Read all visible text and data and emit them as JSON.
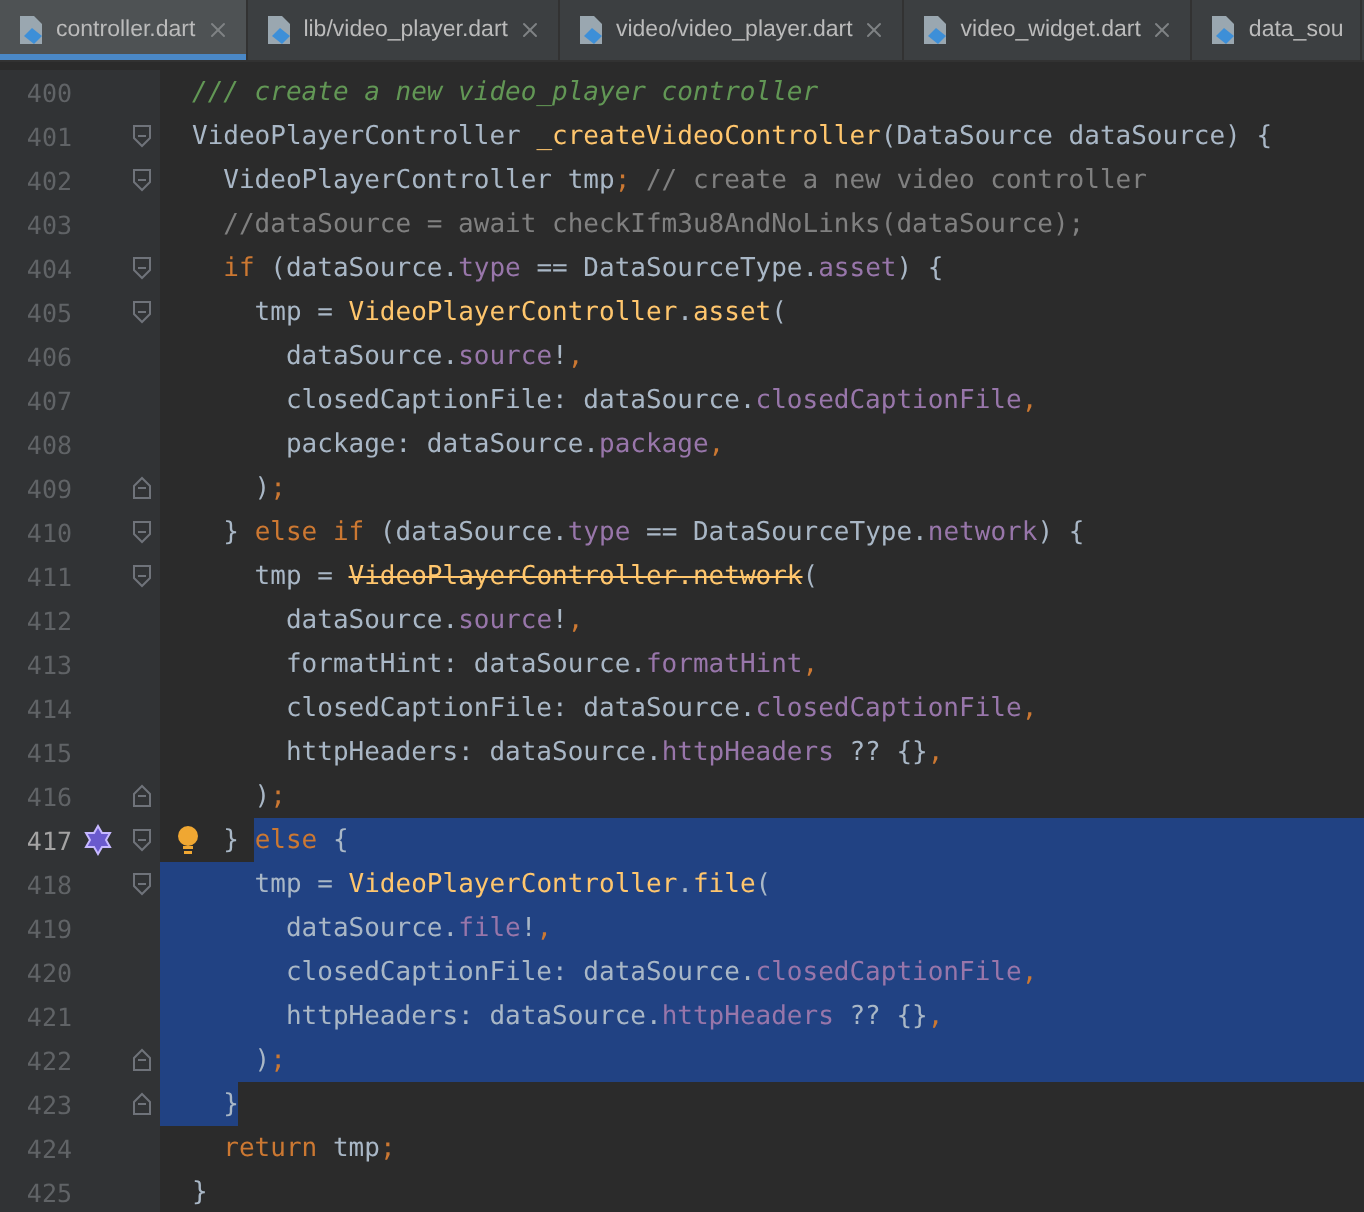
{
  "tabs": [
    {
      "label": "controller.dart",
      "selected": true,
      "closable": true
    },
    {
      "label": "lib/video_player.dart",
      "selected": false,
      "closable": true
    },
    {
      "label": "video/video_player.dart",
      "selected": false,
      "closable": true
    },
    {
      "label": "video_widget.dart",
      "selected": false,
      "closable": true
    },
    {
      "label": "data_sou",
      "selected": false,
      "closable": false
    }
  ],
  "lines": [
    {
      "number": "400",
      "selected": false,
      "tokens": [
        {
          "kind": "doc",
          "text": "/// create a new video_player controller"
        }
      ]
    },
    {
      "number": "401",
      "selected": false,
      "fold_start": true,
      "tokens": [
        {
          "kind": "plain",
          "text": "VideoPlayerController "
        },
        {
          "kind": "function",
          "text": "_createVideoController"
        },
        {
          "kind": "plain",
          "text": "(DataSource dataSource) {"
        }
      ]
    },
    {
      "number": "402",
      "selected": false,
      "fold_start": true,
      "tokens": [
        {
          "kind": "plain",
          "text": "  VideoPlayerController tmp"
        },
        {
          "kind": "keyword",
          "text": ";"
        },
        {
          "kind": "comment",
          "text": " // create a new video controller"
        }
      ]
    },
    {
      "number": "403",
      "selected": false,
      "tokens": [
        {
          "kind": "comment",
          "text": "  //dataSource = await checkIfm3u8AndNoLinks(dataSource);"
        }
      ]
    },
    {
      "number": "404",
      "selected": false,
      "fold_start": true,
      "tokens": [
        {
          "kind": "keyword",
          "text": "  if"
        },
        {
          "kind": "plain",
          "text": " (dataSource."
        },
        {
          "kind": "field",
          "text": "type"
        },
        {
          "kind": "plain",
          "text": " == DataSourceType."
        },
        {
          "kind": "field",
          "text": "asset"
        },
        {
          "kind": "plain",
          "text": ") {"
        }
      ]
    },
    {
      "number": "405",
      "selected": false,
      "fold_start": true,
      "tokens": [
        {
          "kind": "plain",
          "text": "    tmp = "
        },
        {
          "kind": "function",
          "text": "VideoPlayerController"
        },
        {
          "kind": "plain",
          "text": "."
        },
        {
          "kind": "function",
          "text": "asset"
        },
        {
          "kind": "plain",
          "text": "("
        }
      ]
    },
    {
      "number": "406",
      "selected": false,
      "tokens": [
        {
          "kind": "plain",
          "text": "      dataSource."
        },
        {
          "kind": "field",
          "text": "source"
        },
        {
          "kind": "plain",
          "text": "!"
        },
        {
          "kind": "keyword",
          "text": ","
        }
      ]
    },
    {
      "number": "407",
      "selected": false,
      "tokens": [
        {
          "kind": "plain",
          "text": "      closedCaptionFile: dataSource."
        },
        {
          "kind": "field",
          "text": "closedCaptionFile"
        },
        {
          "kind": "keyword",
          "text": ","
        }
      ]
    },
    {
      "number": "408",
      "selected": false,
      "tokens": [
        {
          "kind": "plain",
          "text": "      package: dataSource."
        },
        {
          "kind": "field",
          "text": "package"
        },
        {
          "kind": "keyword",
          "text": ","
        }
      ]
    },
    {
      "number": "409",
      "selected": false,
      "fold_end": true,
      "tokens": [
        {
          "kind": "plain",
          "text": "    )"
        },
        {
          "kind": "keyword",
          "text": ";"
        }
      ]
    },
    {
      "number": "410",
      "selected": false,
      "fold_start": true,
      "tokens": [
        {
          "kind": "plain",
          "text": "  } "
        },
        {
          "kind": "keyword",
          "text": "else if"
        },
        {
          "kind": "plain",
          "text": " (dataSource."
        },
        {
          "kind": "field",
          "text": "type"
        },
        {
          "kind": "plain",
          "text": " == DataSourceType."
        },
        {
          "kind": "field",
          "text": "network"
        },
        {
          "kind": "plain",
          "text": ") {"
        }
      ]
    },
    {
      "number": "411",
      "selected": false,
      "fold_start": true,
      "tokens": [
        {
          "kind": "plain",
          "text": "    tmp = "
        },
        {
          "kind": "deprecated",
          "text": "VideoPlayerController.network"
        },
        {
          "kind": "plain",
          "text": "("
        }
      ]
    },
    {
      "number": "412",
      "selected": false,
      "tokens": [
        {
          "kind": "plain",
          "text": "      dataSource."
        },
        {
          "kind": "field",
          "text": "source"
        },
        {
          "kind": "plain",
          "text": "!"
        },
        {
          "kind": "keyword",
          "text": ","
        }
      ]
    },
    {
      "number": "413",
      "selected": false,
      "tokens": [
        {
          "kind": "plain",
          "text": "      formatHint: dataSource."
        },
        {
          "kind": "field",
          "text": "formatHint"
        },
        {
          "kind": "keyword",
          "text": ","
        }
      ]
    },
    {
      "number": "414",
      "selected": false,
      "tokens": [
        {
          "kind": "plain",
          "text": "      closedCaptionFile: dataSource."
        },
        {
          "kind": "field",
          "text": "closedCaptionFile"
        },
        {
          "kind": "keyword",
          "text": ","
        }
      ]
    },
    {
      "number": "415",
      "selected": false,
      "tokens": [
        {
          "kind": "plain",
          "text": "      httpHeaders: dataSource."
        },
        {
          "kind": "field",
          "text": "httpHeaders"
        },
        {
          "kind": "plain",
          "text": " ?? {}"
        },
        {
          "kind": "keyword",
          "text": ","
        }
      ]
    },
    {
      "number": "416",
      "selected": false,
      "fold_end": true,
      "tokens": [
        {
          "kind": "plain",
          "text": "    )"
        },
        {
          "kind": "keyword",
          "text": ";"
        }
      ]
    },
    {
      "number": "417",
      "selected": false,
      "fold_start": true,
      "marker": true,
      "bulb": true,
      "tokens": [
        {
          "kind": "plain",
          "text": "  } ",
          "selected": false
        },
        {
          "kind": "keyword",
          "text": "else",
          "selected": true
        },
        {
          "kind": "plain",
          "text": " {",
          "selected": true
        }
      ]
    },
    {
      "number": "418",
      "selected": true,
      "fold_start": true,
      "tokens": [
        {
          "kind": "plain",
          "text": "    tmp = "
        },
        {
          "kind": "function",
          "text": "VideoPlayerController"
        },
        {
          "kind": "plain",
          "text": "."
        },
        {
          "kind": "function",
          "text": "file"
        },
        {
          "kind": "plain",
          "text": "("
        }
      ]
    },
    {
      "number": "419",
      "selected": true,
      "tokens": [
        {
          "kind": "plain",
          "text": "      dataSource."
        },
        {
          "kind": "field",
          "text": "file"
        },
        {
          "kind": "plain",
          "text": "!"
        },
        {
          "kind": "keyword",
          "text": ","
        }
      ]
    },
    {
      "number": "420",
      "selected": true,
      "tokens": [
        {
          "kind": "plain",
          "text": "      closedCaptionFile: dataSource."
        },
        {
          "kind": "field",
          "text": "closedCaptionFile"
        },
        {
          "kind": "keyword",
          "text": ","
        }
      ]
    },
    {
      "number": "421",
      "selected": true,
      "tokens": [
        {
          "kind": "plain",
          "text": "      httpHeaders: dataSource."
        },
        {
          "kind": "field",
          "text": "httpHeaders"
        },
        {
          "kind": "plain",
          "text": " ?? {}"
        },
        {
          "kind": "keyword",
          "text": ","
        }
      ]
    },
    {
      "number": "422",
      "selected": true,
      "fold_end": true,
      "tokens": [
        {
          "kind": "plain",
          "text": "    )"
        },
        {
          "kind": "keyword",
          "text": ";"
        }
      ]
    },
    {
      "number": "423",
      "selected": true,
      "selection_ends_at_text": true,
      "fold_end": true,
      "tokens": [
        {
          "kind": "plain",
          "text": "  }"
        }
      ]
    },
    {
      "number": "424",
      "selected": false,
      "tokens": [
        {
          "kind": "keyword",
          "text": "  return"
        },
        {
          "kind": "plain",
          "text": " tmp"
        },
        {
          "kind": "keyword",
          "text": ";"
        }
      ]
    },
    {
      "number": "425",
      "selected": false,
      "tokens": [
        {
          "kind": "plain",
          "text": "}"
        }
      ]
    }
  ]
}
